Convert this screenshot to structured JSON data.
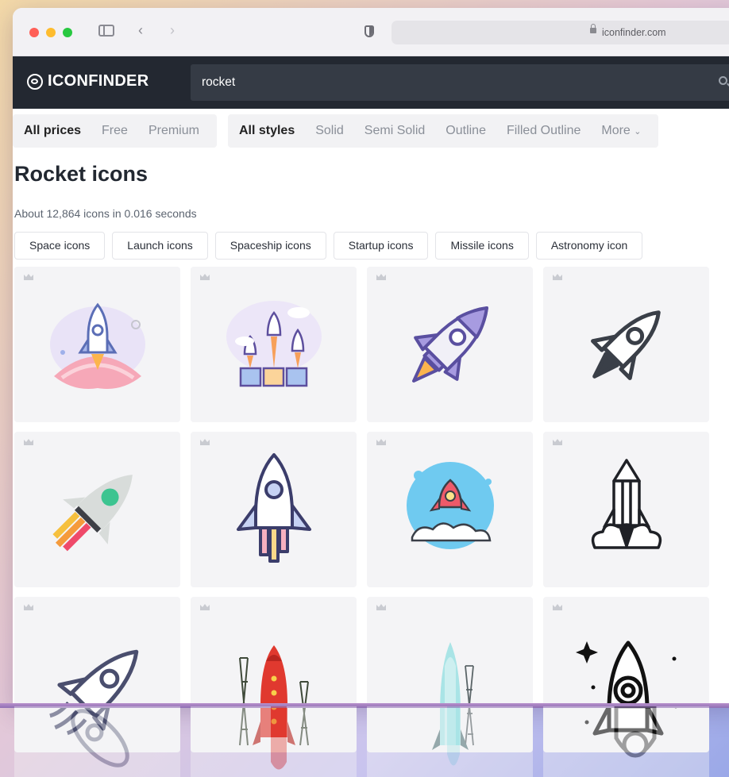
{
  "browser": {
    "url": "iconfinder.com"
  },
  "header": {
    "brand": "ICONFINDER",
    "search_value": "rocket"
  },
  "filters": {
    "prices": [
      "All prices",
      "Free",
      "Premium"
    ],
    "styles": [
      "All styles",
      "Solid",
      "Semi Solid",
      "Outline",
      "Filled Outline",
      "More"
    ]
  },
  "page": {
    "title": "Rocket icons",
    "result_count": "About 12,864 icons in 0.016 seconds"
  },
  "related_tags": [
    "Space icons",
    "Launch icons",
    "Spaceship icons",
    "Startup icons",
    "Missile icons",
    "Astronomy icon"
  ],
  "icons": [
    "rocket-planet-icon",
    "three-rockets-boxes-icon",
    "rocket-purple-flame-icon",
    "rocket-outline-dark-icon",
    "rocket-flat-green-icon",
    "rocket-outline-pastel-icon",
    "rocket-launch-circle-icon",
    "pencil-rocket-icon",
    "rocket-line-icon",
    "rocket-launch-tower-red-icon",
    "rocket-launch-tower-teal-icon",
    "rocket-stars-icon"
  ],
  "colors": {
    "header_bg": "#232831",
    "accent": "#7466c4"
  }
}
